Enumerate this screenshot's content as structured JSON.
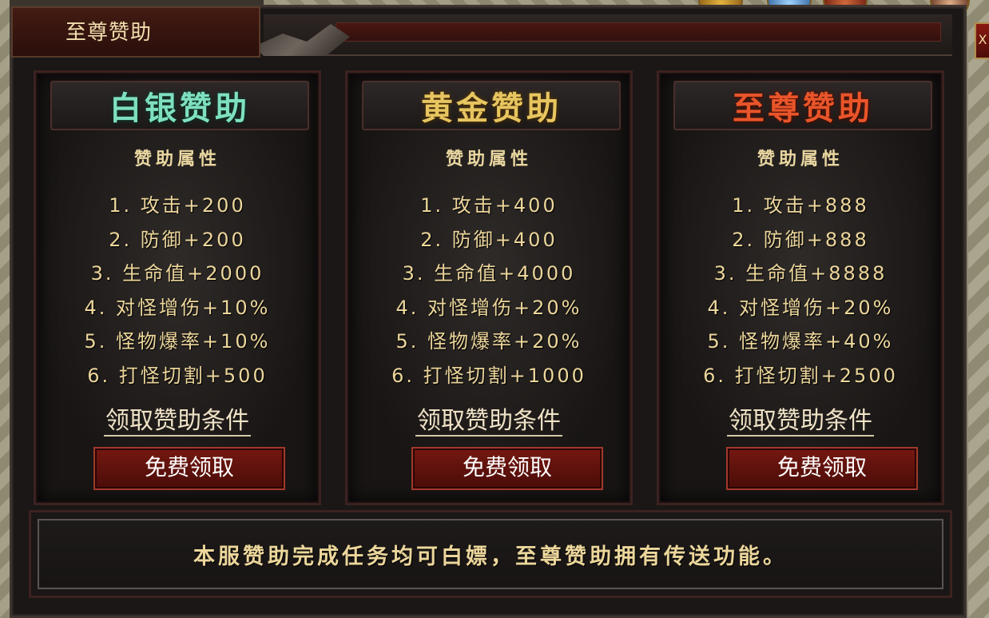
{
  "window": {
    "title": "至尊赞助",
    "close_label": "X"
  },
  "tiers": [
    {
      "name": "白银赞助",
      "attr_heading": "赞助属性",
      "attributes": [
        "1. 攻击+200",
        "2. 防御+200",
        "3. 生命值+2000",
        "4. 对怪增伤+10%",
        "5. 怪物爆率+10%",
        "6. 打怪切割+500"
      ],
      "condition_link": "领取赞助条件",
      "claim_button": "免费领取",
      "title_color": "#7fe0c0"
    },
    {
      "name": "黄金赞助",
      "attr_heading": "赞助属性",
      "attributes": [
        "1. 攻击+400",
        "2. 防御+400",
        "3. 生命值+4000",
        "4. 对怪增伤+20%",
        "5. 怪物爆率+20%",
        "6. 打怪切割+1000"
      ],
      "condition_link": "领取赞助条件",
      "claim_button": "免费领取",
      "title_color": "#e7c560"
    },
    {
      "name": "至尊赞助",
      "attr_heading": "赞助属性",
      "attributes": [
        "1. 攻击+888",
        "2. 防御+888",
        "3. 生命值+8888",
        "4. 对怪增伤+20%",
        "5. 怪物爆率+40%",
        "6. 打怪切割+2500"
      ],
      "condition_link": "领取赞助条件",
      "claim_button": "免费领取",
      "title_color": "#e8552a"
    }
  ],
  "notice": "本服赞助完成任务均可白嫖，至尊赞助拥有传送功能。"
}
